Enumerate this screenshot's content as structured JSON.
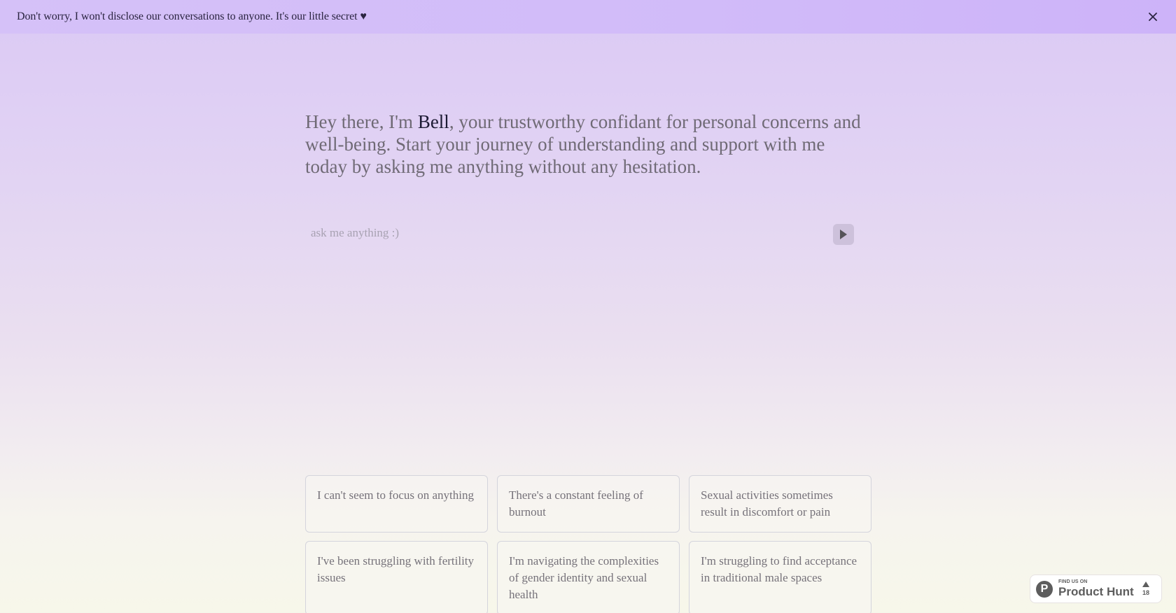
{
  "banner": {
    "message": "Don't worry, I won't disclose our conversations to anyone. It's our little secret ♥",
    "close_icon": "close-icon"
  },
  "hero": {
    "prefix": "Hey there, I'm ",
    "name": "Bell",
    "suffix": ", your trustworthy confidant for personal concerns and well-being. Start your journey of understanding and support with me today by asking me anything without any hesitation."
  },
  "ask": {
    "placeholder": "ask me anything :)",
    "value": "",
    "send_icon": "play-icon"
  },
  "suggestions": [
    {
      "label": "I can't seem to focus on anything"
    },
    {
      "label": "There's a constant feeling of burnout"
    },
    {
      "label": "Sexual activities sometimes result in discomfort or pain"
    },
    {
      "label": "I've been struggling with fertility issues"
    },
    {
      "label": "I'm navigating the complexities of gender identity and sexual health"
    },
    {
      "label": "I'm struggling to find acceptance in traditional male spaces"
    }
  ],
  "product_hunt": {
    "logo_letter": "P",
    "small_label": "FIND US ON",
    "big_label": "Product Hunt",
    "upvotes": "18"
  },
  "colors": {
    "banner_bg": "#d3bcf9",
    "accent_name": "#1c1a33",
    "body_text": "#6f6a75",
    "send_button_bg": "#cdc1db"
  }
}
